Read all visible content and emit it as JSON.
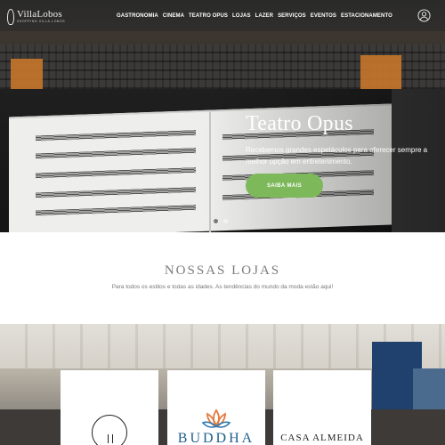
{
  "header": {
    "logo": {
      "name": "VillaLobos",
      "tagline": "SHOPPING VILLA-LOBOS"
    },
    "nav": [
      "GASTRONOMIA",
      "CINEMA",
      "TEATRO OPUS",
      "LOJAS",
      "LAZER",
      "SERVIÇOS",
      "EVENTOS",
      "ESTACIONAMENTO"
    ],
    "account_icon": "user-circle-icon"
  },
  "hero": {
    "title": "Teatro Opus",
    "description": "Recebemos grandes espetáculos para oferecer sempre a melhor opção em entretenimento.",
    "cta_label": "SAIBA MAIS",
    "cta_color": "#7db85a",
    "slides_total": 2,
    "active_slide": 2
  },
  "stores_section": {
    "title": "NOSSAS LOJAS",
    "subtitle": "Para todos os estilos e todas as idades. As tendências do mundo da moda estão aqui!",
    "stores": [
      {
        "logo_icon": "circle-monogram-icon"
      },
      {
        "name": "BUDDHA",
        "logo_icon": "lotus-icon",
        "brand_color": "#1d5e8c"
      },
      {
        "name": "CASA ALMEIDA"
      }
    ]
  }
}
